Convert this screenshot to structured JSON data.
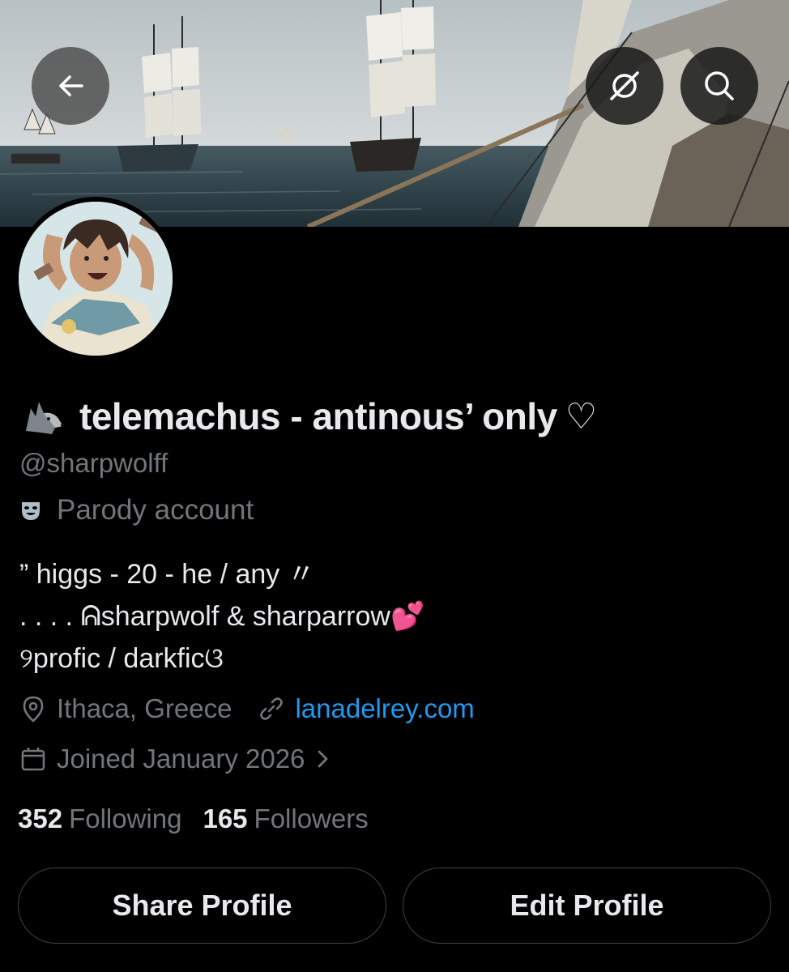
{
  "header": {
    "back_icon": "arrow-left-icon",
    "grok_icon": "grok-icon",
    "search_icon": "search-icon"
  },
  "profile": {
    "display_name": "telemachus - antinous’ only",
    "name_prefix_icon": "wolf-emoji",
    "name_suffix": "♡",
    "handle": "@sharpwolff",
    "parody_label": "Parody account",
    "bio": [
      "” higgs - 20 - he / any 〃",
      ". . . . ᕱsharpwolf & sharparrow💕",
      "୨profic / darkficଓ"
    ],
    "location": "Ithaca, Greece",
    "website": "lanadelrey.com",
    "joined": "Joined January 2026",
    "following_count": "352",
    "following_label": "Following",
    "followers_count": "165",
    "followers_label": "Followers"
  },
  "actions": {
    "share_label": "Share Profile",
    "edit_label": "Edit Profile"
  },
  "colors": {
    "background": "#000000",
    "text": "#e7e9ea",
    "muted": "#71767b",
    "link": "#1d9bf0",
    "border": "#3d4145"
  }
}
